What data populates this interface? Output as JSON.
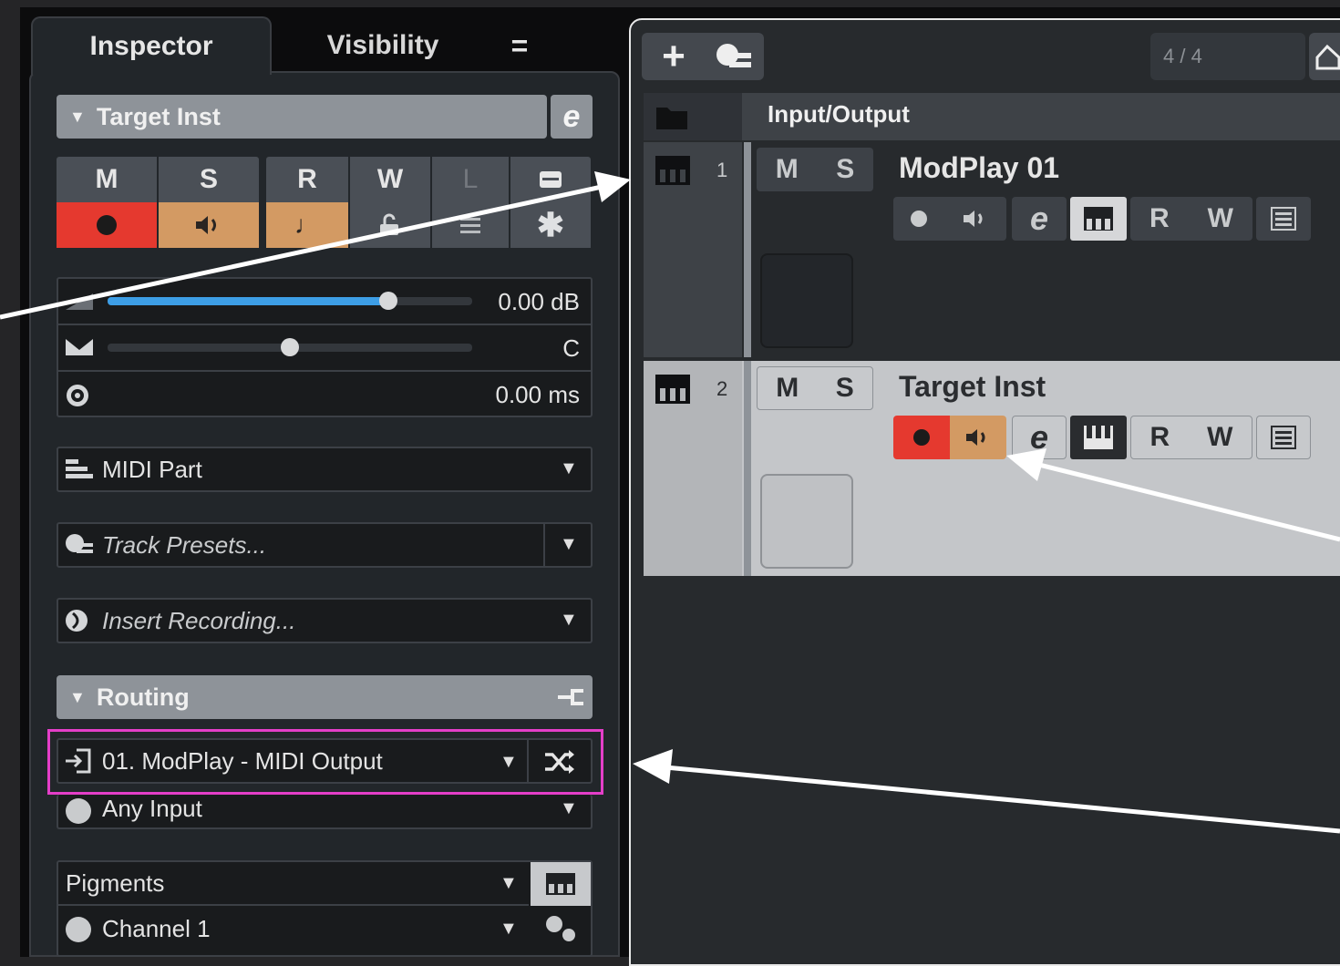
{
  "inspector": {
    "tabs": [
      "Inspector",
      "Visibility"
    ],
    "menu_glyph": "=",
    "track_section": {
      "title": "Target Inst",
      "edit_glyph": "e"
    },
    "state_buttons": [
      "M",
      "S",
      "R",
      "W",
      "L"
    ],
    "volume": "0.00 dB",
    "pan": "C",
    "delay": "0.00 ms",
    "midi_part": "MIDI Part",
    "track_presets": "Track Presets...",
    "insert_recording": "Insert Recording...",
    "routing_section": {
      "title": "Routing"
    },
    "midi_input": "01. ModPlay - MIDI Output",
    "audio_input": "Any Input",
    "output_instrument": "Pigments",
    "channel": "Channel 1",
    "colors": {
      "record": "#e5392f",
      "monitor": "#d39a63",
      "highlight_box": "#e43ec8",
      "volume_bar": "#3d9ee6"
    }
  },
  "project": {
    "toolbar": {
      "time_signature": "4 / 4"
    },
    "folder_track": {
      "name": "Input/Output"
    },
    "tracks": [
      {
        "number": "1",
        "name": "ModPlay 01",
        "mute": "M",
        "solo": "S",
        "read": "R",
        "write": "W",
        "edit": "e"
      },
      {
        "number": "2",
        "name": "Target Inst",
        "mute": "M",
        "solo": "S",
        "read": "R",
        "write": "W",
        "edit": "e"
      }
    ]
  }
}
